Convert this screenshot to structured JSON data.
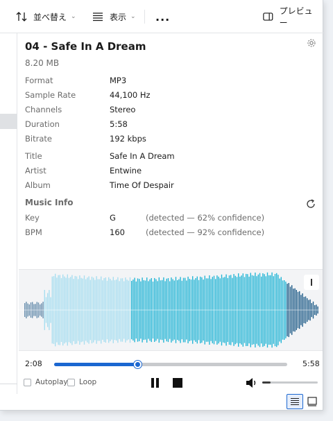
{
  "toolbar": {
    "sort_label": "並べ替え",
    "view_label": "表示",
    "more_label": "...",
    "preview_label": "プレビュー"
  },
  "file": {
    "title": "04 - Safe In A Dream",
    "size": "8.20 MB"
  },
  "properties": [
    {
      "label": "Format",
      "value": "MP3"
    },
    {
      "label": "Sample Rate",
      "value": "44,100 Hz"
    },
    {
      "label": "Channels",
      "value": "Stereo"
    },
    {
      "label": "Duration",
      "value": "5:58"
    },
    {
      "label": "Bitrate",
      "value": "192 kbps"
    },
    {
      "label": "Title",
      "value": "Safe In A Dream"
    },
    {
      "label": "Artist",
      "value": "Entwine"
    },
    {
      "label": "Album",
      "value": "Time Of Despair"
    }
  ],
  "music_info": {
    "heading": "Music Info",
    "rows": [
      {
        "label": "Key",
        "value": "G",
        "note": "(detected — 62% confidence)"
      },
      {
        "label": "BPM",
        "value": "160",
        "note": "(detected — 92% confidence)"
      }
    ]
  },
  "player": {
    "current_time": "2:08",
    "total_time": "5:58",
    "progress": 0.357,
    "volume": 0.15,
    "autoplay_label": "Autoplay",
    "loop_label": "Loop",
    "autoplay_checked": false,
    "loop_checked": false
  },
  "colors": {
    "accent": "#1b67d1",
    "wave_played": "#a8def0",
    "wave_unplayed": "#25b6d6",
    "wave_dark": "#1f5c88",
    "wave_gray": "#6a8fae"
  },
  "icons": {
    "sort": "sort-icon",
    "view": "view-lines-icon",
    "preview": "preview-pane-icon",
    "settings": "gear-icon",
    "refresh": "refresh-icon",
    "pause": "pause-icon",
    "stop": "stop-icon",
    "volume": "speaker-icon"
  }
}
